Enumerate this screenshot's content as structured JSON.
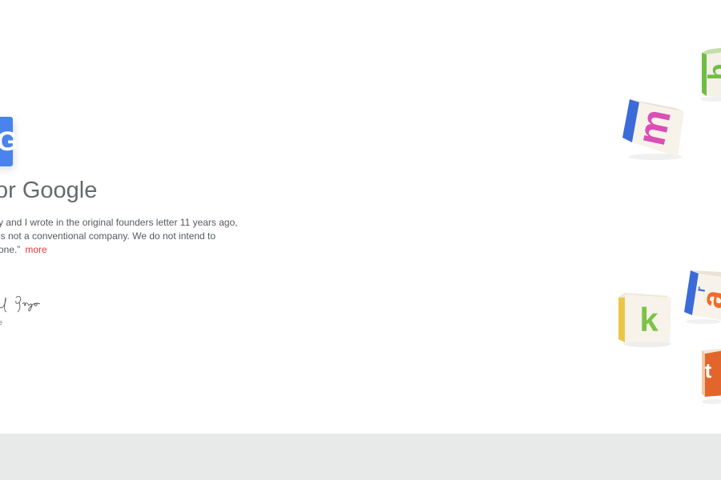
{
  "hero": {
    "g_letter": "G",
    "heading": "or Google",
    "quote_lines": [
      "y and I wrote in the original founders letter 11 years ago,",
      "is not a conventional company. We do not intend to",
      "one.”"
    ],
    "more_label": "more",
    "signature_caption": "e"
  },
  "cubes": [
    {
      "letter": "m",
      "color": "#d94fb6",
      "side_color": "#3b6bd9"
    },
    {
      "letter": "b",
      "color": "#6fbd45",
      "side_color": "#6fbd45"
    },
    {
      "letter": "k",
      "color": "#7cc247",
      "side_color": "#e9c646"
    },
    {
      "letter": "a",
      "color": "#f26b2a",
      "side_color": "#3b6bd9"
    },
    {
      "letter": "t",
      "color": "#ffffff",
      "side_color": "#e2662b"
    }
  ],
  "colors": {
    "link": "#e8383d",
    "footer": "#e8eaea",
    "heading": "#666a6e"
  }
}
